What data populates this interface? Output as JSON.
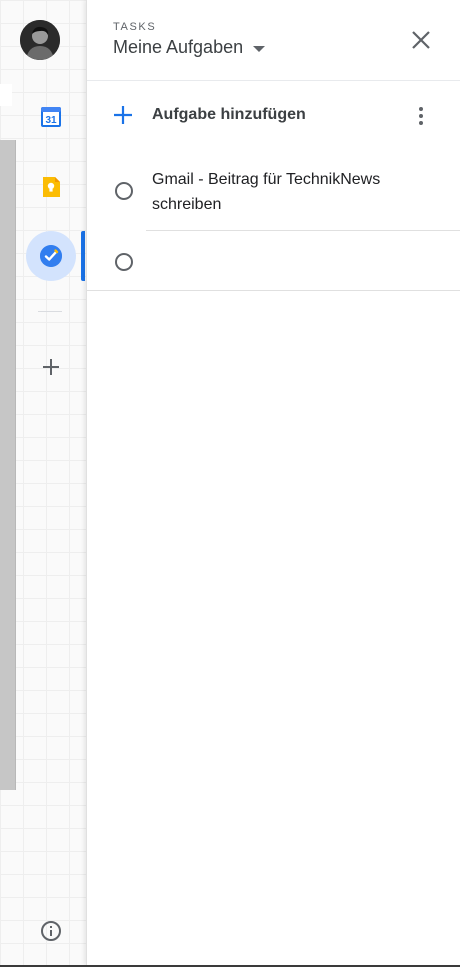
{
  "panel": {
    "eyebrow": "TASKS",
    "list_title": "Meine Aufgaben",
    "add_task_label": "Aufgabe hinzufügen"
  },
  "tasks": [
    {
      "title": "Gmail - Beitrag für TechnikNews schreiben",
      "completed": false
    },
    {
      "title": "",
      "completed": false
    }
  ],
  "rail": {
    "calendar_day": "31",
    "items": [
      "calendar-icon",
      "keep-icon",
      "tasks-icon"
    ],
    "active_item": "tasks-icon"
  },
  "colors": {
    "accent_blue": "#1a73e8",
    "active_bg": "#d3e3fd",
    "keep_yellow": "#fbbc04",
    "text_primary": "#202124",
    "text_secondary": "#5f6368"
  }
}
